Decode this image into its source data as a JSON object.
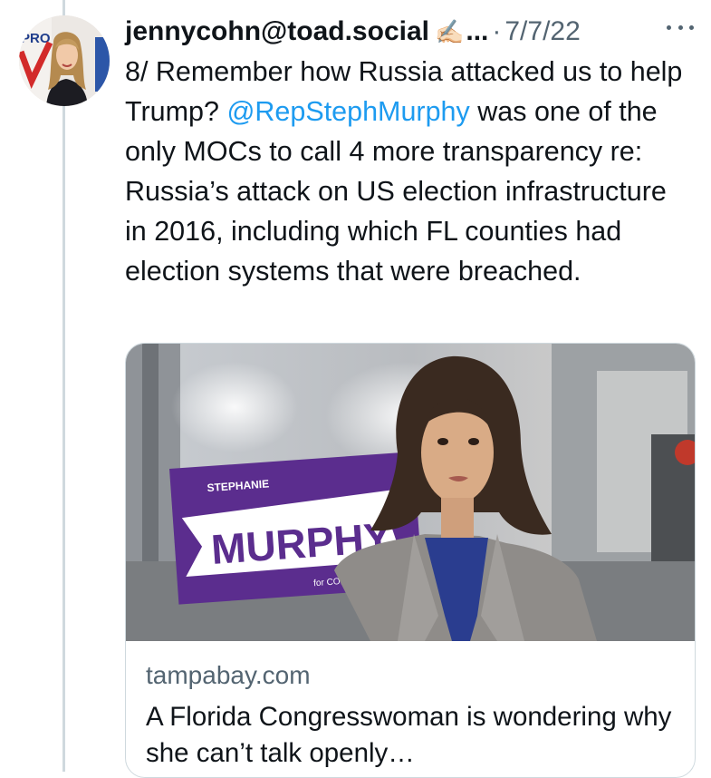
{
  "tweet": {
    "author_handle": "jennycohn@toad.social",
    "author_emoji": "✍🏻",
    "name_truncation": "...",
    "separator": "·",
    "date": "7/7/22",
    "text_before_mention": "8/ Remember how Russia attacked us to help Trump? ",
    "mention": "@RepStephMurphy",
    "text_after_mention": " was one of the only MOCs to call 4 more transparency re: Russia’s attack on US election infrastructure in 2016, including which FL counties had election systems that were breached.",
    "more_icon": "more-horizontal-icon",
    "mention_color": "#1d9bf0"
  },
  "avatar": {
    "sign_text": "PRO"
  },
  "card": {
    "domain": "tampabay.com",
    "title": "A Florida Congresswoman is wondering why she can’t talk openly…",
    "image": {
      "sign_top_text": "STEPHANIE",
      "sign_main_text": "MURPHY",
      "sign_bottom_text": "for CONGRESS",
      "sign_color": "#5b2d8e"
    }
  }
}
